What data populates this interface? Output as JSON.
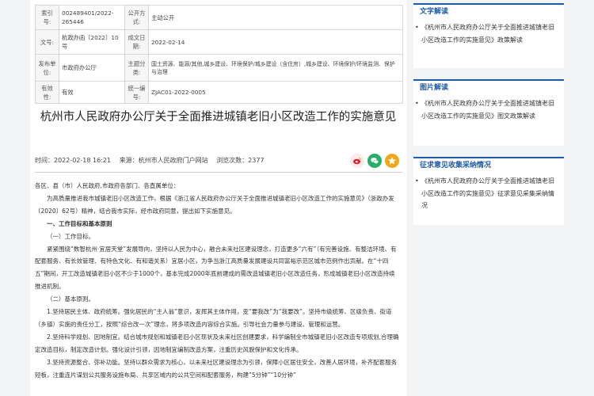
{
  "meta_table": {
    "rows": [
      {
        "l1": "索引号:",
        "v1": "002489401/2022-265446",
        "l2": "公开方式:",
        "v2": "主动公开"
      },
      {
        "l1": "文号:",
        "v1": "杭政办函〔2022〕10号",
        "l2": "成文日期:",
        "v2": "2022-02-14"
      },
      {
        "l1": "发布单位:",
        "v1": "市政府办公厅",
        "l2": "主题分类:",
        "v2": "国土资源、能源/其他,城乡建设、环境保护/城乡建设（含住房）,城乡建设、环境保护/环境监测、保护与治理"
      },
      {
        "l1": "有效性:",
        "v1": "有效",
        "l2": "统一编号:",
        "v2": "ZJAC01-2022-0005"
      }
    ]
  },
  "article": {
    "title": "杭州市人民政府办公厅关于全面推进城镇老旧小区改造工作的实施意见",
    "time": "时间：2022-02-18 16:21",
    "source": "来源：杭州市人民政府门户网站",
    "views": "浏览次数：2377",
    "paragraphs": [
      {
        "text": "各区、县（市）人民政府,市政府各部门、各直属单位：",
        "style": "plain"
      },
      {
        "text": "为高质量推进我市城镇老旧小区改造工作，根据《浙江省人民政府办公厅关于全面推进城镇老旧小区改造工作的实施意见》（浙政办发〔2020〕62号）精神，结合我市实际，经市政府同意，提出如下实施意见。",
        "style": "indent"
      },
      {
        "text": "一、工作目标和基本原则",
        "style": "indent-bold"
      },
      {
        "text": "（一）工作目标。",
        "style": "indent"
      },
      {
        "text": "紧紧围绕“数智杭州·宜居天堂”发展导向，坚持以人民为中心，融合未来社区建设理念，打造更多“六有”（有完善设施、有整洁环境、有配套服务、有长效管理、有特色文化、有和谐关系）宜居小区，为争当浙江高质量发展建设共同富裕示范区城市范例作出贡献。在“十四五”期间，开工改造城镇老旧小区不少于1000个，基本完成2000年底前建成的需改造城镇老旧小区改造任务，形成城镇老旧小区改造持续推进机制。",
        "style": "indent"
      },
      {
        "text": "（二）基本原则。",
        "style": "indent"
      },
      {
        "text": "1.坚持居民主体、政府统筹。强化居民的“主人翁”意识，发挥其主体作用，变“要我改”为“我要改”。坚持市级统筹、区级负责、街道（乡镇）实施的责任分工，按照“综合改一次”理念，将多项改造内容综合实施。引导社会力量参与建设、管理和运营。",
        "style": "indent"
      },
      {
        "text": "2.坚持科学规划、因地制宜。结合城市规划和城镇老旧小区现状及未来社区创建要求，科学编制全市城镇老旧小区改造专项规划,合理确定改造目标，制定改造计划。强化设计引领，因地制宜编制改造方案，注重历史风貌保护和文化传承。",
        "style": "indent"
      },
      {
        "text": "3.坚持资源整合、弥补功能。坚持以群众需求为核心，以未来社区建设理念为引领，保障小区居住安全，改善人居环境，补齐配套服务短板，注重连片谋划公共服务设施布局、共享区域内的公共空间和配套服务，构建“5分钟”“10分钟”",
        "style": "indent"
      }
    ]
  },
  "share": {
    "weibo_color": "#e6162d",
    "wechat_color": "#2aae67",
    "star_color": "#f2a81d"
  },
  "sidebar": {
    "sections": [
      {
        "heading": "文字解读",
        "bullet": "•",
        "item": "《杭州市人民政府办公厅关于全面推进城镇老旧小区改造工作的实施意见》政策解读"
      },
      {
        "heading": "图片解读",
        "bullet": "•",
        "item": "《杭州市人民政府办公厅关于全面推进城镇老旧小区改造工作的实施意见》图文政策解读"
      },
      {
        "heading": "征求意见收集采纳情况",
        "bullet": "•",
        "item": "《杭州市人民政府办公厅关于全面推进城镇老旧小区改造工作的实施意见》征求意见采集采纳情况"
      }
    ]
  }
}
